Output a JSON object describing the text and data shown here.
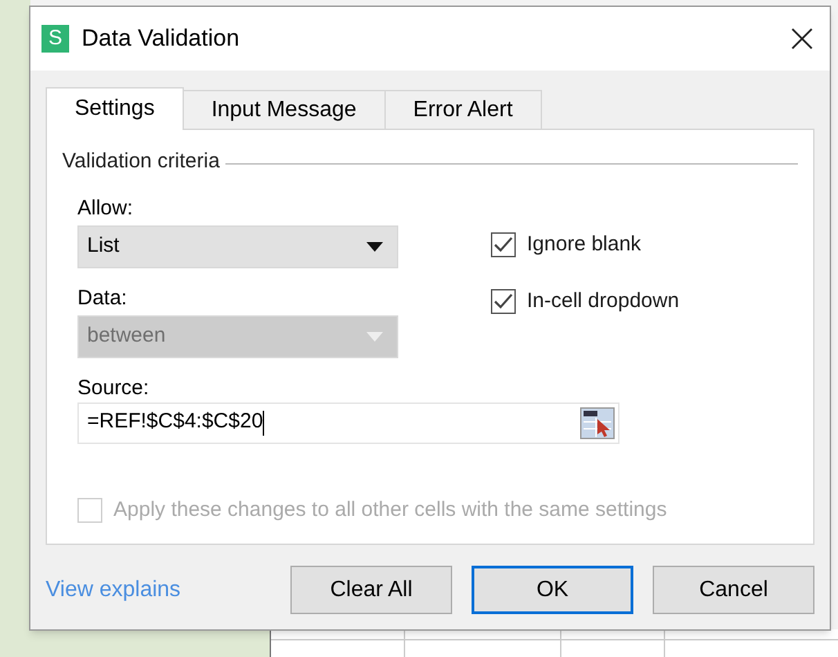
{
  "window": {
    "title": "Data Validation",
    "app_icon_letter": "S"
  },
  "tabs": [
    {
      "label": "Settings",
      "selected": true
    },
    {
      "label": "Input Message",
      "selected": false
    },
    {
      "label": "Error Alert",
      "selected": false
    }
  ],
  "group_title": "Validation criteria",
  "allow": {
    "label": "Allow:",
    "value": "List",
    "disabled": false
  },
  "data": {
    "label": "Data:",
    "value": "between",
    "disabled": true
  },
  "checkboxes": [
    {
      "label": "Ignore blank",
      "checked": true,
      "disabled": false
    },
    {
      "label": "In-cell dropdown",
      "checked": true,
      "disabled": false
    }
  ],
  "source": {
    "label": "Source:",
    "value": "=REF!$C$4:$C$20"
  },
  "apply_all": {
    "label": "Apply these changes to all other cells with the same settings",
    "checked": false,
    "disabled": true
  },
  "link": "View explains",
  "buttons": [
    {
      "label": "Clear All",
      "default": false
    },
    {
      "label": "OK",
      "default": true
    },
    {
      "label": "Cancel",
      "default": false
    }
  ]
}
